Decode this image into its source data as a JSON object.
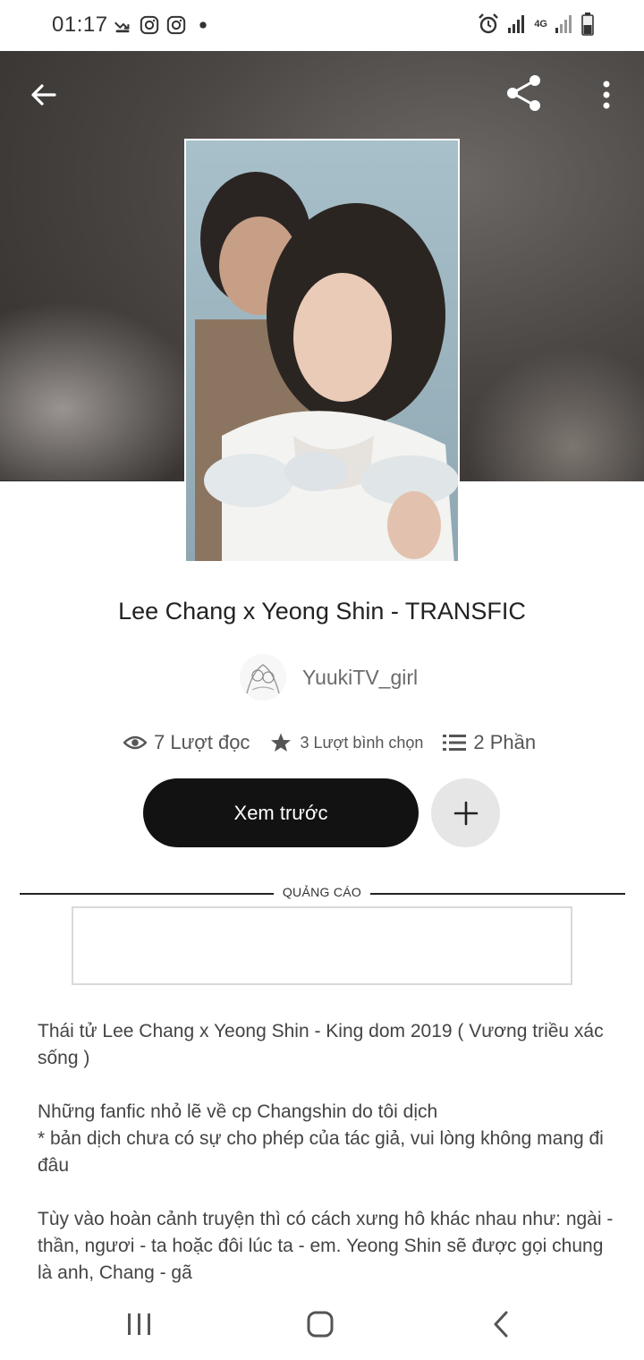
{
  "status_bar": {
    "time": "01:17",
    "left_icons": [
      "missed-call-icon",
      "instagram-icon",
      "instagram-icon",
      "dot-icon"
    ],
    "right_icons": [
      "alarm-icon",
      "signal-icon",
      "4g-icon",
      "signal-icon",
      "battery-icon"
    ],
    "network_label": "4G"
  },
  "toolbar": {
    "back_icon": "arrow-left-icon",
    "share_icon": "share-icon",
    "more_icon": "more-vert-icon"
  },
  "story": {
    "title": "Lee Chang x Yeong Shin - TRANSFIC",
    "author": "YuukiTV_girl"
  },
  "stats": {
    "reads": "7 Lượt đọc",
    "votes": "3 Lượt bình chọn",
    "parts": "2 Phần"
  },
  "actions": {
    "read_label": "Xem trước",
    "add_icon": "plus-icon"
  },
  "ad": {
    "label": "QUẢNG CÁO"
  },
  "description": [
    "Thái tử Lee Chang x Yeong Shin - King dom 2019 ( Vương triều xác sống )",
    "Những fanfic nhỏ lẽ về cp Changshin do tôi dịch\n* bản dịch chưa có sự cho phép của tác giả, vui lòng không mang đi đâu",
    "Tùy vào hoàn cảnh truyện thì có cách xưng hô khác nhau như: ngài - thần, ngươi - ta hoặc đôi lúc ta - em. Yeong Shin sẽ được gọi chung là anh, Chang - gã"
  ],
  "nav": {
    "recents_icon": "recents-icon",
    "home_icon": "home-icon",
    "back_icon": "back-chevron-icon"
  },
  "colors": {
    "primary_button": "#121212",
    "secondary_button": "#e6e6e6",
    "hero_background": "#4a4644"
  }
}
